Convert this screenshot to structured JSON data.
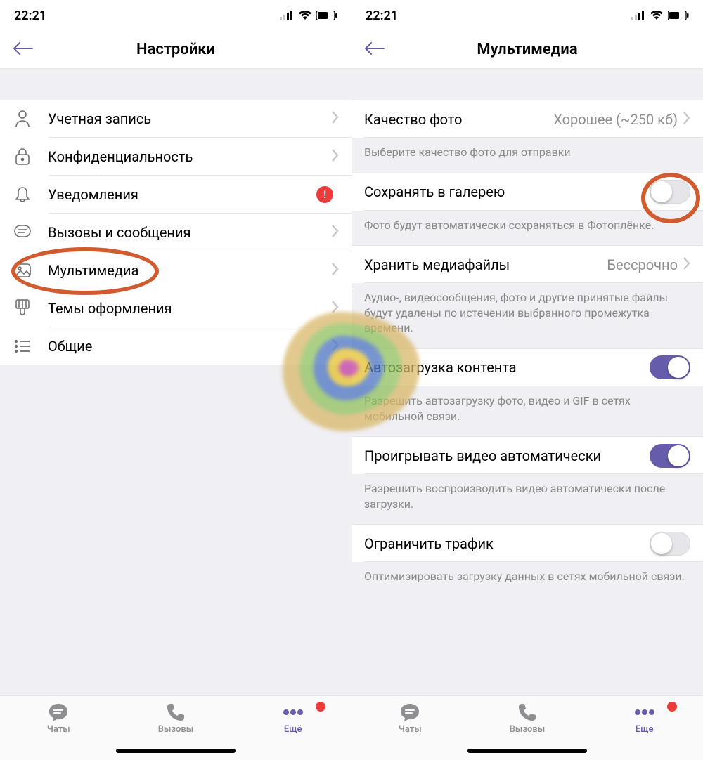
{
  "status": {
    "time": "22:21"
  },
  "left": {
    "title": "Настройки",
    "rows": [
      {
        "label": "Учетная запись"
      },
      {
        "label": "Конфиденциальность"
      },
      {
        "label": "Уведомления",
        "alert": true
      },
      {
        "label": "Вызовы и сообщения"
      },
      {
        "label": "Мультимедиа"
      },
      {
        "label": "Темы оформления"
      },
      {
        "label": "Общие"
      }
    ]
  },
  "right": {
    "title": "Мультимедиа",
    "photoQuality": {
      "label": "Качество фото",
      "value": "Хорошее (~250 кб)"
    },
    "photoQualityHint": "Выберите качество фото для отправки",
    "saveGallery": {
      "label": "Сохранять в галерею"
    },
    "saveGalleryHint": "Фото будут автоматически сохраняться в Фотоплёнке.",
    "storeMedia": {
      "label": "Хранить медиафайлы",
      "value": "Бессрочно"
    },
    "storeMediaHint": "Аудио-, видеосообщения, фото и другие принятые файлы будут удалены по истечении выбранного промежутка времени.",
    "autoDownload": {
      "label": "Автозагрузка контента"
    },
    "autoDownloadHint": "Разрешить автозагрузку фото, видео и GIF в сетях мобильной связи.",
    "autoPlay": {
      "label": "Проигрывать видео автоматически"
    },
    "autoPlayHint": "Разрешить воспроизводить видео автоматически после загрузки.",
    "limitData": {
      "label": "Ограничить трафик"
    },
    "limitDataHint": "Оптимизировать загрузку данных в сетях мобильной связи."
  },
  "tabs": {
    "chats": "Чаты",
    "calls": "Вызовы",
    "more": "Ещё"
  }
}
